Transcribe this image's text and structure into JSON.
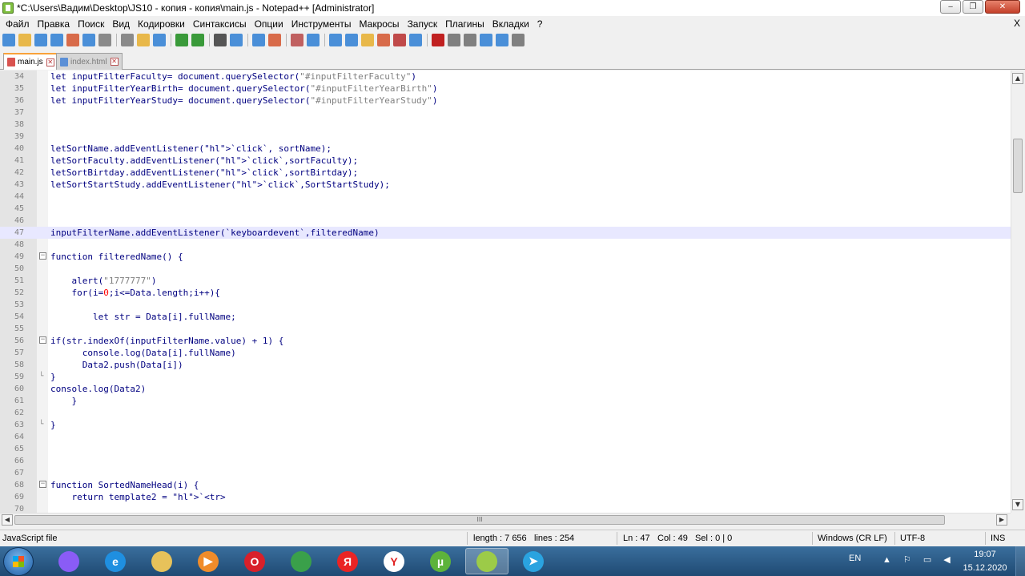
{
  "window": {
    "title": "*C:\\Users\\Вадим\\Desktop\\JS10 - копия - копия\\main.js - Notepad++ [Administrator]",
    "minimize": "‒",
    "restore": "❐",
    "close": "✕"
  },
  "menu": [
    "Файл",
    "Правка",
    "Поиск",
    "Вид",
    "Кодировки",
    "Синтаксисы",
    "Опции",
    "Инструменты",
    "Макросы",
    "Запуск",
    "Плагины",
    "Вкладки",
    "?"
  ],
  "menu_close": "X",
  "tabs": [
    {
      "label": "main.js",
      "active": true
    },
    {
      "label": "index.html",
      "active": false
    }
  ],
  "editor": {
    "current_line": 47,
    "lines": [
      {
        "n": "34",
        "text": "let inputFilterFaculty= document.querySelector(\"#inputFilterFaculty\")"
      },
      {
        "n": "35",
        "text": "let inputFilterYearBirth= document.querySelector(\"#inputFilterYearBirth\")"
      },
      {
        "n": "36",
        "text": "let inputFilterYearStudy= document.querySelector(\"#inputFilterYearStudy\")"
      },
      {
        "n": "37",
        "text": ""
      },
      {
        "n": "38",
        "text": ""
      },
      {
        "n": "39",
        "text": ""
      },
      {
        "n": "40",
        "text": "letSortName.addEventListener(`click`, sortName);"
      },
      {
        "n": "41",
        "text": "letSortFaculty.addEventListener(`click`,sortFaculty);"
      },
      {
        "n": "42",
        "text": "letSortBirtday.addEventListener(`click`,sortBirtday);"
      },
      {
        "n": "43",
        "text": "letSortStartStudy.addEventListener(`click`,SortStartStudy);"
      },
      {
        "n": "44",
        "text": ""
      },
      {
        "n": "45",
        "text": ""
      },
      {
        "n": "46",
        "text": ""
      },
      {
        "n": "47",
        "text": "inputFilterName.addEventListener(`keyboardevent`,filteredName)"
      },
      {
        "n": "48",
        "text": ""
      },
      {
        "n": "49",
        "text": "function filteredName() {"
      },
      {
        "n": "50",
        "text": ""
      },
      {
        "n": "51",
        "text": "    alert(\"1777777\")"
      },
      {
        "n": "52",
        "text": "    for(i=0;i<=Data.length;i++){"
      },
      {
        "n": "53",
        "text": ""
      },
      {
        "n": "54",
        "text": "        let str = Data[i].fullName;"
      },
      {
        "n": "55",
        "text": ""
      },
      {
        "n": "56",
        "text": "if(str.indexOf(inputFilterName.value) + 1) {"
      },
      {
        "n": "57",
        "text": "      console.log(Data[i].fullName)"
      },
      {
        "n": "58",
        "text": "      Data2.push(Data[i])"
      },
      {
        "n": "59",
        "text": "}"
      },
      {
        "n": "60",
        "text": "console.log(Data2)"
      },
      {
        "n": "61",
        "text": "    }"
      },
      {
        "n": "62",
        "text": ""
      },
      {
        "n": "63",
        "text": "}"
      },
      {
        "n": "64",
        "text": ""
      },
      {
        "n": "65",
        "text": ""
      },
      {
        "n": "66",
        "text": ""
      },
      {
        "n": "67",
        "text": ""
      },
      {
        "n": "68",
        "text": "function SortedNameHead(i) {"
      },
      {
        "n": "69",
        "text": "    return template2 = `<tr>"
      },
      {
        "n": "70",
        "text": ""
      }
    ]
  },
  "hscroll_mark": "III",
  "status": {
    "file_type": "JavaScript file",
    "length": "length : 7 656",
    "lines": "lines : 254",
    "ln": "Ln : 47",
    "col": "Col : 49",
    "sel": "Sel : 0 | 0",
    "eol": "Windows (CR LF)",
    "encoding": "UTF-8",
    "mode": "INS"
  },
  "taskbar": {
    "apps": [
      {
        "name": "alice",
        "glyph": "",
        "color": "#8a5cf6"
      },
      {
        "name": "internet-explorer",
        "glyph": "e",
        "color": "#1f8fe0"
      },
      {
        "name": "file-explorer",
        "glyph": "",
        "color": "#e7c25a"
      },
      {
        "name": "media-player",
        "glyph": "▶",
        "color": "#f08c2a"
      },
      {
        "name": "opera",
        "glyph": "O",
        "color": "#d8202a"
      },
      {
        "name": "chrome",
        "glyph": "",
        "color": "#3aa04a"
      },
      {
        "name": "yandex",
        "glyph": "Я",
        "color": "#ea2424"
      },
      {
        "name": "yandex-browser",
        "glyph": "Y",
        "color": "#ffffff"
      },
      {
        "name": "utorrent",
        "glyph": "µ",
        "color": "#5db33b"
      },
      {
        "name": "notepad-plus-plus",
        "glyph": "",
        "color": "#9ccb48"
      },
      {
        "name": "telegram",
        "glyph": "➤",
        "color": "#2aa3e0"
      }
    ],
    "lang": "EN",
    "time": "19:07",
    "date": "15.12.2020"
  }
}
